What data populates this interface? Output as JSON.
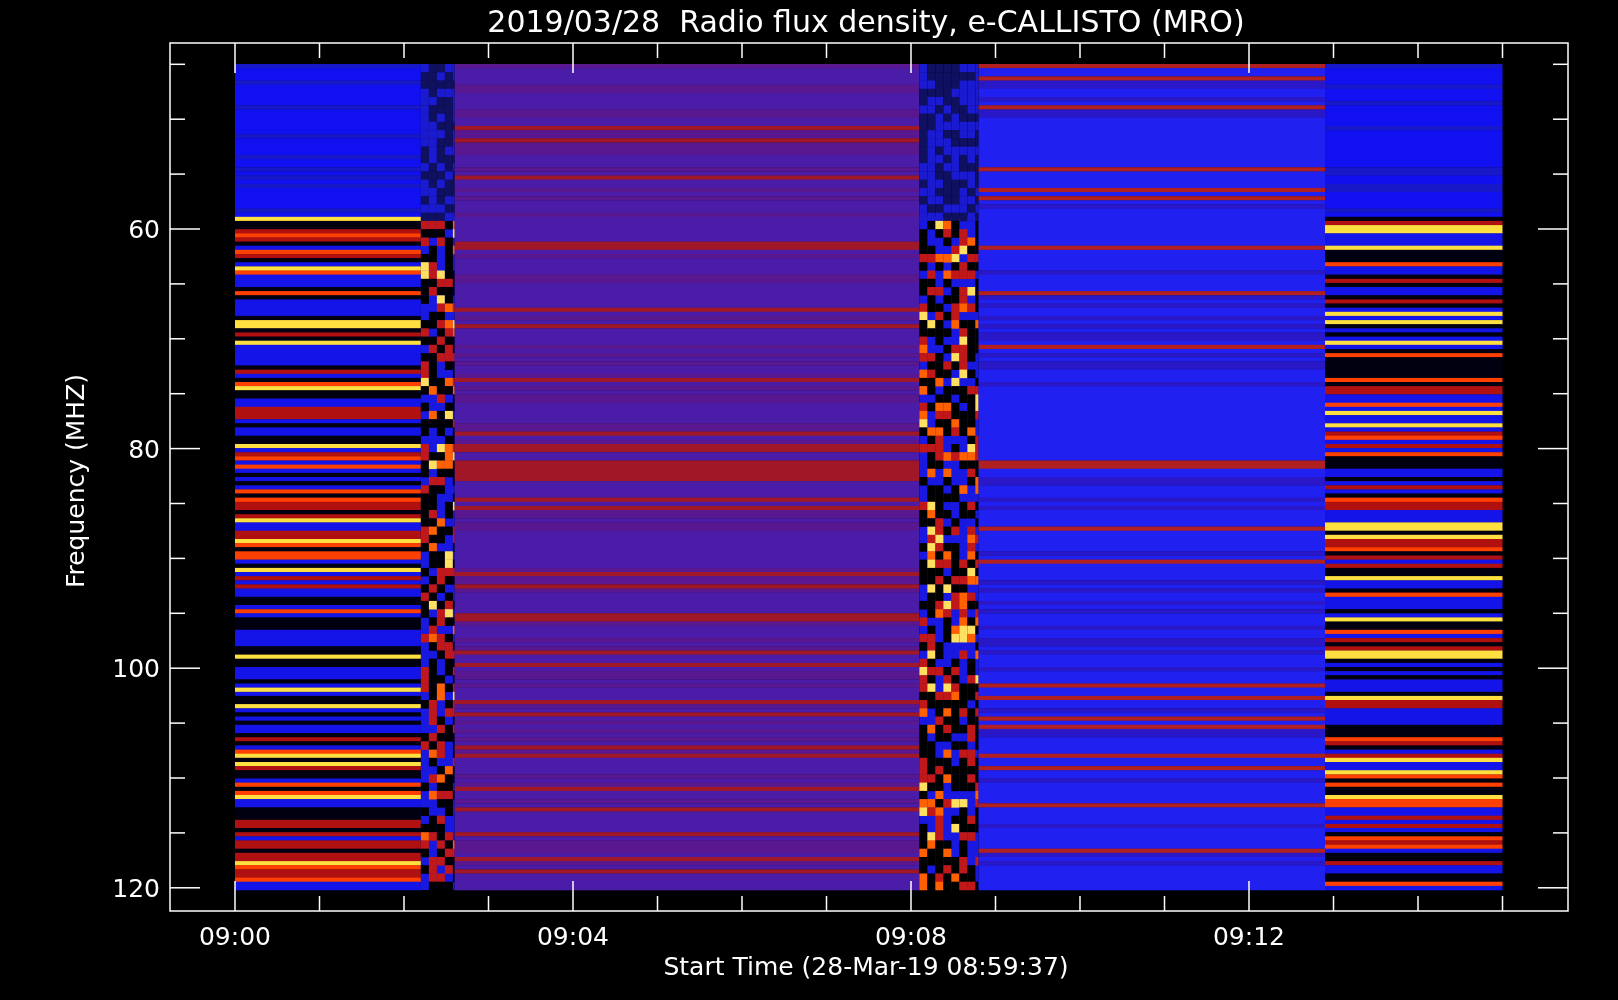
{
  "title": "2019/03/28  Radio flux density, e-CALLISTO (MRO)",
  "y_axis": {
    "label": "Frequency (MHZ)",
    "ticks": [
      "60",
      "80",
      "100",
      "120"
    ]
  },
  "x_axis": {
    "label": "Start Time (28-Mar-19 08:59:37)",
    "ticks": [
      "09:00",
      "09:04",
      "09:08",
      "09:12"
    ]
  }
}
